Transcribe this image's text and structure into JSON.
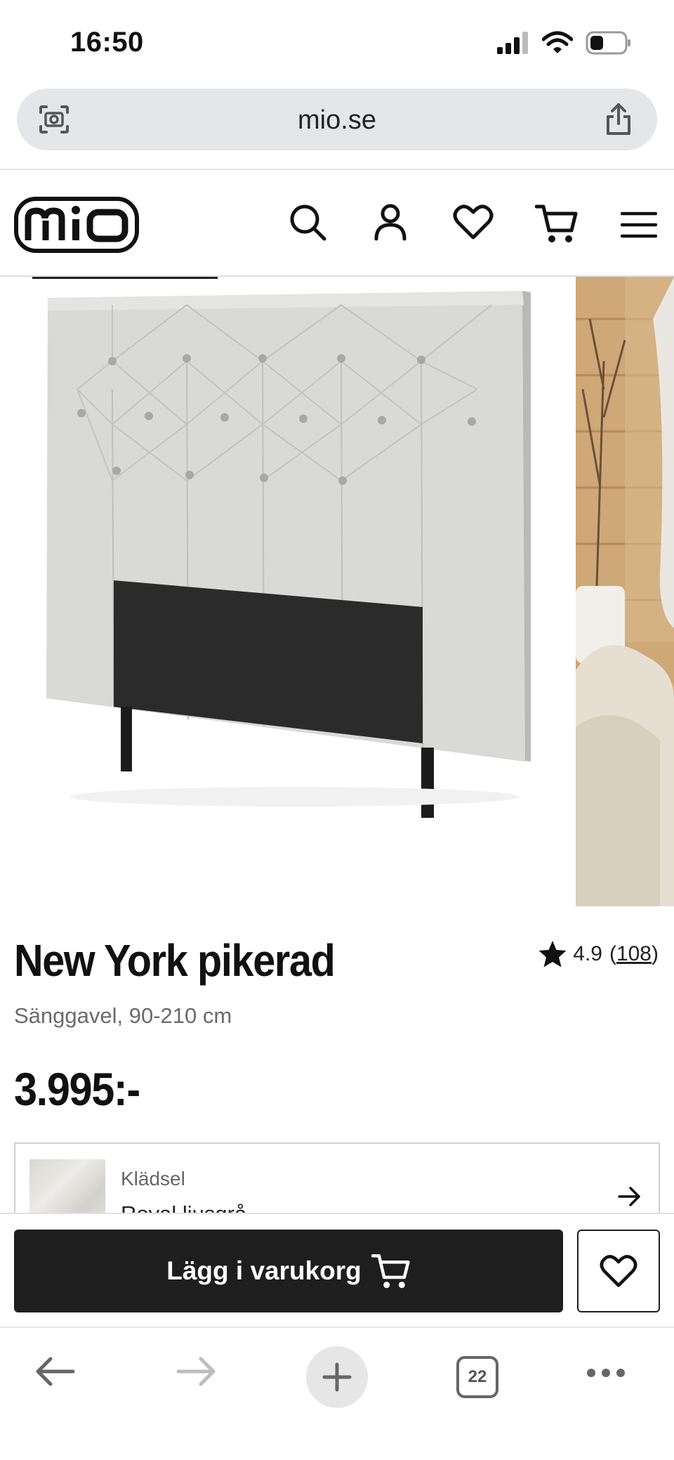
{
  "status": {
    "time": "16:50"
  },
  "browser": {
    "url": "mio.se",
    "tab_count": "22"
  },
  "site": {
    "logo_text": "mio"
  },
  "product": {
    "title": "New York pikerad",
    "rating": "4.9",
    "rating_count": "108",
    "subtitle": "Sänggavel, 90-210 cm",
    "price": "3.995:-"
  },
  "variant": {
    "label": "Klädsel",
    "value": "Royal ljusgrå"
  },
  "cart": {
    "add_label": "Lägg i varukorg"
  },
  "colors": {
    "button_dark": "#1e1e1e",
    "fabric": "#d6d6d4",
    "panel": "#2b2b2b"
  }
}
